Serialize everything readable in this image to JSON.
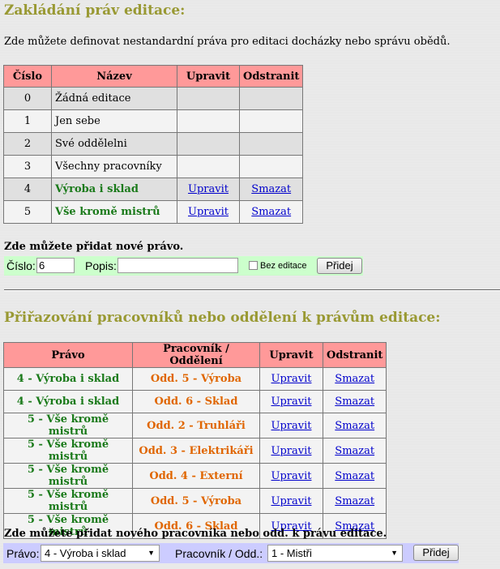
{
  "section1": {
    "title": "Zakládání práv editace:",
    "intro": "Zde můžete definovat nestandardní práva pro editaci docházky nebo správu obědů.",
    "columns": [
      "Číslo",
      "Název",
      "Upravit",
      "Odstranit"
    ],
    "rows": [
      {
        "num": "0",
        "name": "Žádná editace",
        "edit": "",
        "delete": ""
      },
      {
        "num": "1",
        "name": "Jen sebe",
        "edit": "",
        "delete": ""
      },
      {
        "num": "2",
        "name": "Své oddělelni",
        "edit": "",
        "delete": ""
      },
      {
        "num": "3",
        "name": "Všechny pracovníky",
        "edit": "",
        "delete": ""
      },
      {
        "num": "4",
        "name": "Výroba i sklad",
        "edit": "Upravit",
        "delete": "Smazat"
      },
      {
        "num": "5",
        "name": "Vše kromě mistrů",
        "edit": "Upravit",
        "delete": "Smazat"
      }
    ],
    "add_title": "Zde můžete přidat nové právo.",
    "form": {
      "number_label": "Číslo:",
      "number_value": "6",
      "desc_label": "Popis:",
      "desc_value": "",
      "checkbox_label": "Bez editace",
      "submit_label": "Přidej"
    }
  },
  "section2": {
    "title": "Přiřazování pracovníků nebo oddělení k právům editace:",
    "columns": [
      "Právo",
      "Pracovník / Oddělení",
      "Upravit",
      "Odstranit"
    ],
    "rows": [
      {
        "right": "4 - Výroba i sklad",
        "target": "Odd. 5 - Výroba",
        "edit": "Upravit",
        "delete": "Smazat"
      },
      {
        "right": "4 - Výroba i sklad",
        "target": "Odd. 6 - Sklad",
        "edit": "Upravit",
        "delete": "Smazat"
      },
      {
        "right": "5 - Vše kromě mistrů",
        "target": "Odd. 2 - Truhláři",
        "edit": "Upravit",
        "delete": "Smazat"
      },
      {
        "right": "5 - Vše kromě mistrů",
        "target": "Odd. 3 - Elektrikáři",
        "edit": "Upravit",
        "delete": "Smazat"
      },
      {
        "right": "5 - Vše kromě mistrů",
        "target": "Odd. 4 - Externí",
        "edit": "Upravit",
        "delete": "Smazat"
      },
      {
        "right": "5 - Vše kromě mistrů",
        "target": "Odd. 5 - Výroba",
        "edit": "Upravit",
        "delete": "Smazat"
      },
      {
        "right": "5 - Vše kromě mistrů",
        "target": "Odd. 6 - Sklad",
        "edit": "Upravit",
        "delete": "Smazat"
      }
    ],
    "add_title": "Zde můžete přidat nového pracovníka nebo odd. k právu editace.",
    "form": {
      "right_label": "Právo:",
      "right_value": "4 - Výroba i sklad",
      "target_label": "Pracovník / Odd.:",
      "target_value": "1 - Mistři",
      "submit_label": "Přidej"
    }
  },
  "colors": {
    "header_bg": "#ff9999",
    "title": "#999933",
    "green_text": "#1a7a1a",
    "orange_text": "#e06600",
    "form1_bg": "#ccffcc",
    "form2_bg": "#ccccff"
  }
}
